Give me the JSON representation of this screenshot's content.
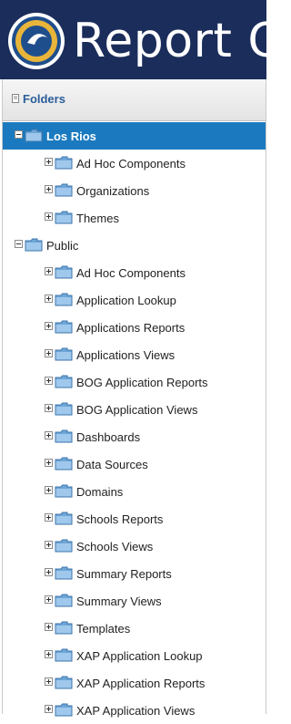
{
  "app": {
    "title": "Report C"
  },
  "panel": {
    "title": "Folders"
  },
  "tree": {
    "los_rios": {
      "label": "Los Rios",
      "children": [
        "Ad Hoc Components",
        "Organizations",
        "Themes"
      ]
    },
    "public": {
      "label": "Public",
      "children": [
        "Ad Hoc Components",
        "Application Lookup",
        "Applications Reports",
        "Applications Views",
        "BOG Application Reports",
        "BOG Application Views",
        "Dashboards",
        "Data Sources",
        "Domains",
        "Schools Reports",
        "Schools Views",
        "Summary Reports",
        "Summary Views",
        "Templates",
        "XAP Application Lookup",
        "XAP Application Reports",
        "XAP Application Views"
      ]
    }
  },
  "colors": {
    "header": "#1b2d5a",
    "selected": "#1b7abf",
    "folder_title": "#2a5d9a"
  }
}
